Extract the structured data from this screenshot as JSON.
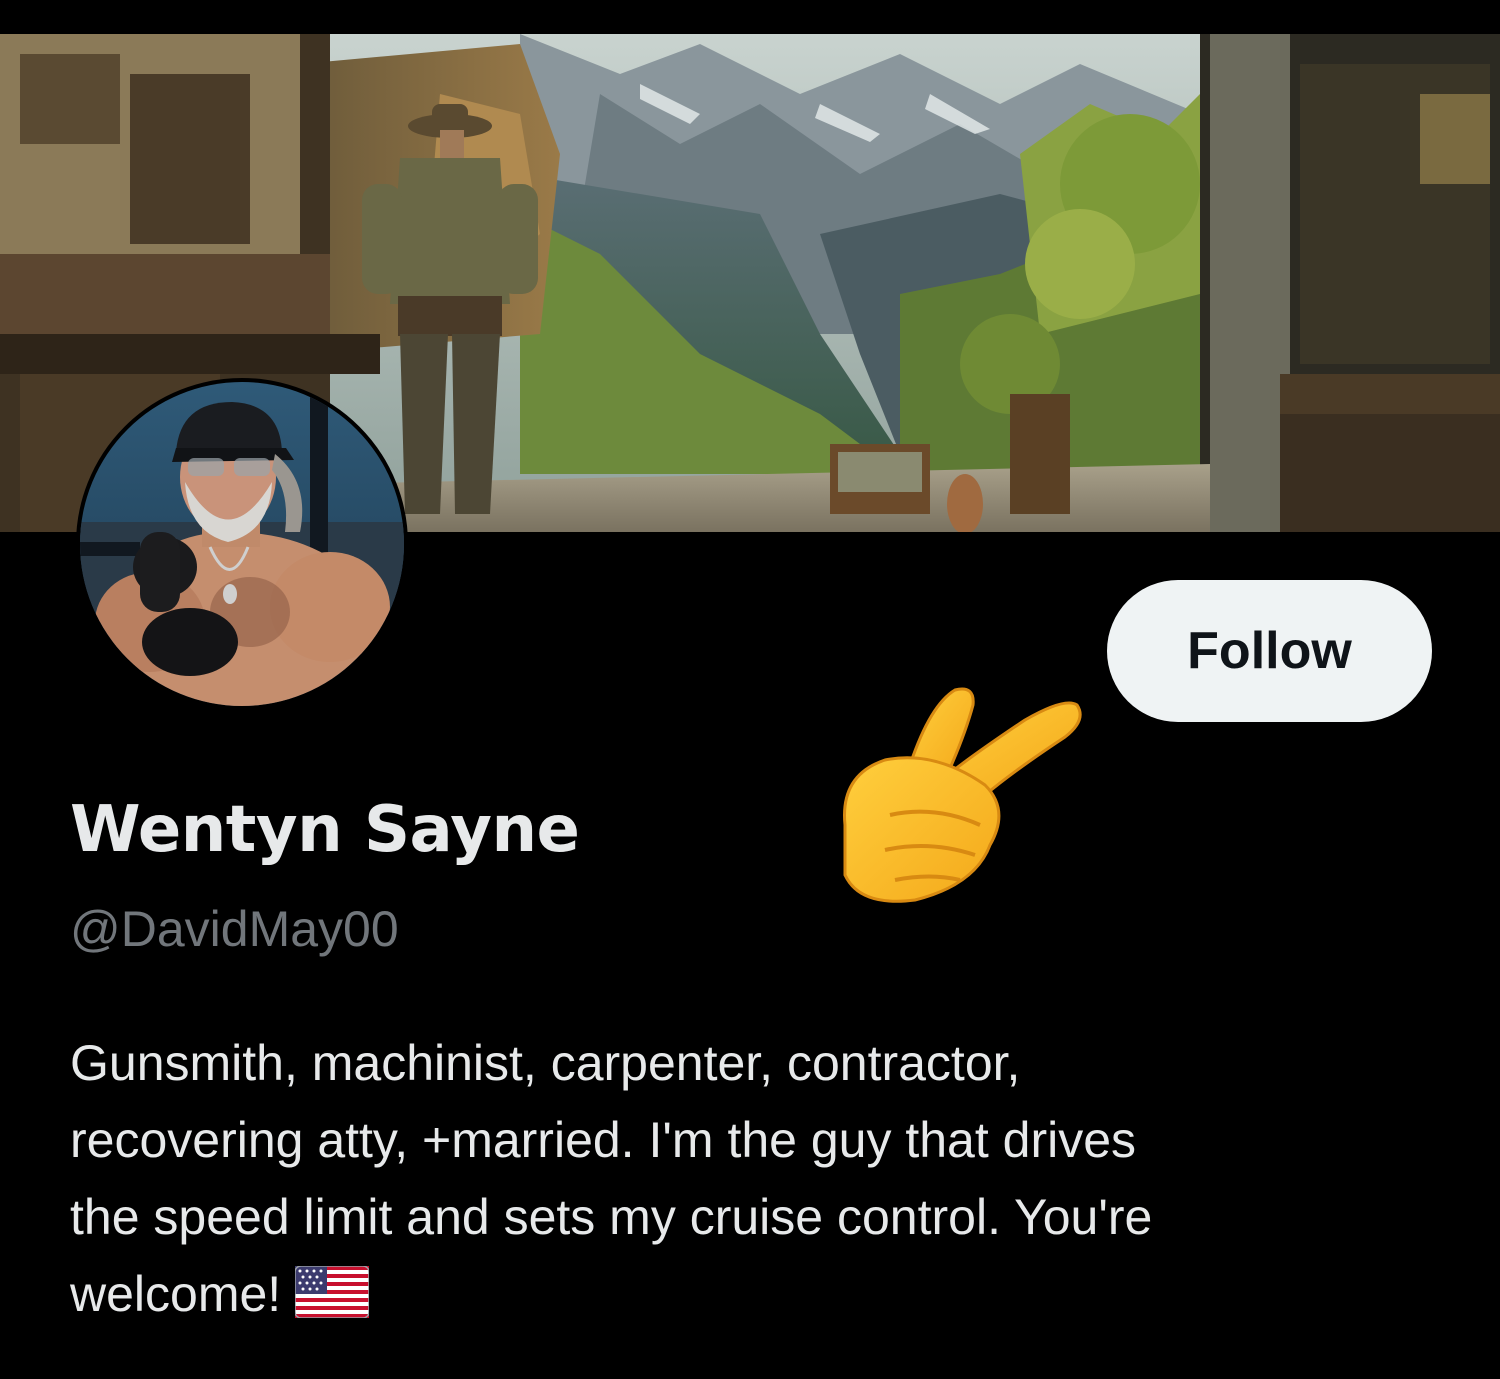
{
  "profile": {
    "display_name": "Wentyn Sayne",
    "handle": "@DavidMay00",
    "bio_lines": [
      "Gunsmith, machinist, carpenter, contractor,",
      "recovering atty, +married. I'm the guy that drives",
      "the speed limit and sets my cruise control. You're",
      "welcome!"
    ],
    "bio_emoji": "us-flag-icon"
  },
  "actions": {
    "follow_label": "Follow"
  },
  "decorations": {
    "pointer": "backhand-index-pointing-right-icon"
  },
  "colors": {
    "background": "#000000",
    "follow_bg": "#eff3f4",
    "follow_text": "#0f1419",
    "name_text": "#e7e9ea",
    "handle_text": "#71767b"
  }
}
